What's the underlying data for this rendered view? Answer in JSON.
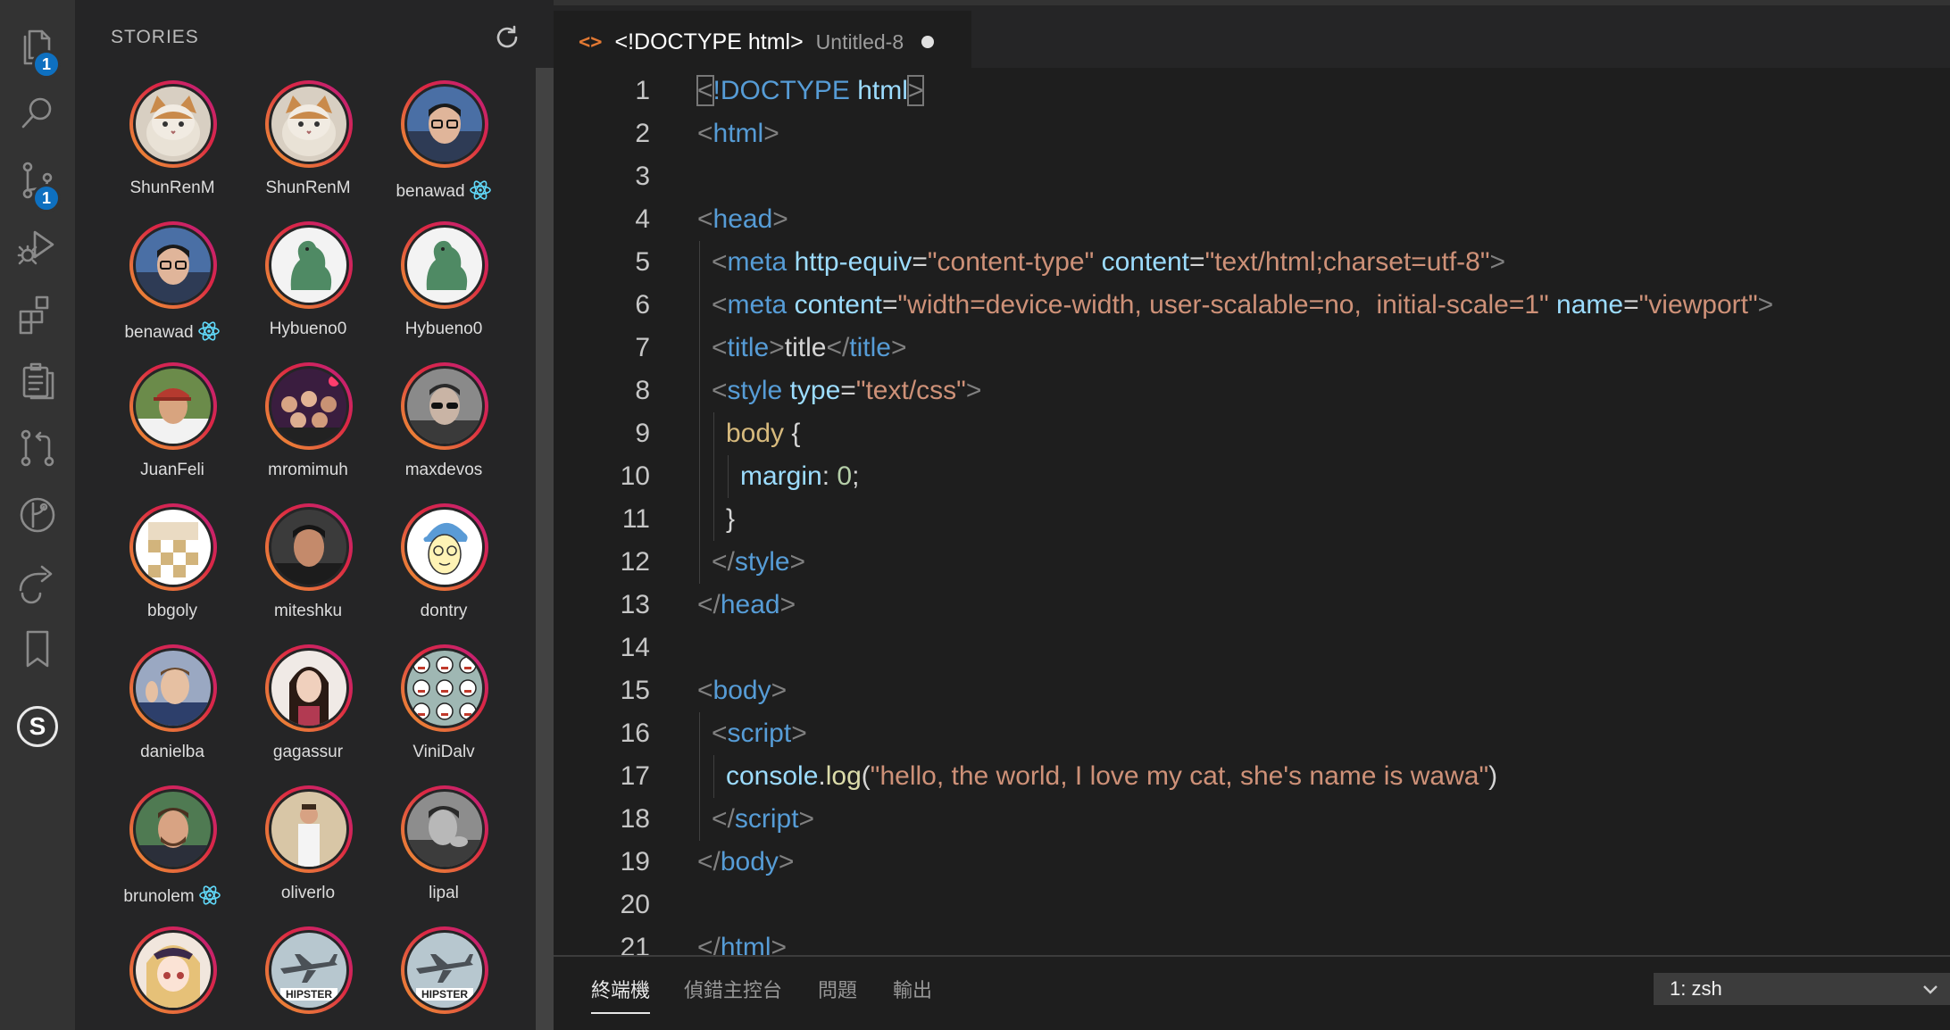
{
  "activity_bar": {
    "items": [
      {
        "name": "explorer",
        "icon": "files-icon",
        "badge": "1"
      },
      {
        "name": "search",
        "icon": "search-icon",
        "badge": ""
      },
      {
        "name": "source-control",
        "icon": "source-control-icon",
        "badge": "1"
      },
      {
        "name": "run-debug",
        "icon": "run-debug-icon",
        "badge": ""
      },
      {
        "name": "extensions",
        "icon": "extensions-icon",
        "badge": ""
      },
      {
        "name": "clipboard",
        "icon": "clipboard-icon",
        "badge": ""
      },
      {
        "name": "pull-requests",
        "icon": "pull-request-icon",
        "badge": ""
      },
      {
        "name": "git-graph",
        "icon": "git-graph-icon",
        "badge": ""
      },
      {
        "name": "live-share",
        "icon": "live-share-icon",
        "badge": ""
      },
      {
        "name": "bookmarks",
        "icon": "bookmark-icon",
        "badge": ""
      },
      {
        "name": "stories",
        "icon": "stories-s-icon",
        "badge": "",
        "glyph": "S"
      }
    ]
  },
  "sidebar": {
    "title": "STORIES",
    "refresh_icon": "refresh-icon",
    "stories": [
      {
        "name": "ShunRenM",
        "react": false,
        "avatar": "cat"
      },
      {
        "name": "ShunRenM",
        "react": false,
        "avatar": "cat"
      },
      {
        "name": "benawad",
        "react": true,
        "avatar": "man-glasses"
      },
      {
        "name": "benawad",
        "react": true,
        "avatar": "man-glasses"
      },
      {
        "name": "Hybueno0",
        "react": false,
        "avatar": "dino"
      },
      {
        "name": "Hybueno0",
        "react": false,
        "avatar": "dino"
      },
      {
        "name": "JuanFeli",
        "react": false,
        "avatar": "man-cap"
      },
      {
        "name": "mromimuh",
        "react": false,
        "avatar": "group"
      },
      {
        "name": "maxdevos",
        "react": false,
        "avatar": "man-sunglasses"
      },
      {
        "name": "bbgoly",
        "react": false,
        "avatar": "pixel"
      },
      {
        "name": "miteshku",
        "react": false,
        "avatar": "man-dark"
      },
      {
        "name": "dontry",
        "react": false,
        "avatar": "cartoon"
      },
      {
        "name": "danielba",
        "react": false,
        "avatar": "man-wave"
      },
      {
        "name": "gagassur",
        "react": false,
        "avatar": "woman"
      },
      {
        "name": "ViniDalv",
        "react": false,
        "avatar": "pattern"
      },
      {
        "name": "brunolem",
        "react": true,
        "avatar": "man-beard"
      },
      {
        "name": "oliverlo",
        "react": false,
        "avatar": "man-standing"
      },
      {
        "name": "lipal",
        "react": false,
        "avatar": "man-bw"
      },
      {
        "name": "",
        "react": false,
        "avatar": "anime"
      },
      {
        "name": "",
        "react": false,
        "avatar": "plane",
        "caption": "HIPSTER"
      },
      {
        "name": "",
        "react": false,
        "avatar": "plane",
        "caption": "HIPSTER"
      }
    ]
  },
  "editor": {
    "tab": {
      "icon": "<>",
      "title": "<!DOCTYPE html>",
      "description": "Untitled-8"
    },
    "lines": [
      {
        "n": "1",
        "indent": 0,
        "tokens": [
          [
            "punc-box",
            "<"
          ],
          [
            "tag",
            "!DOCTYPE"
          ],
          [
            "txt",
            " "
          ],
          [
            "attr",
            "html"
          ],
          [
            "punc-box",
            ">"
          ]
        ]
      },
      {
        "n": "2",
        "indent": 0,
        "tokens": [
          [
            "punc",
            "<"
          ],
          [
            "tag",
            "html"
          ],
          [
            "punc",
            ">"
          ]
        ]
      },
      {
        "n": "3",
        "indent": 0,
        "tokens": []
      },
      {
        "n": "4",
        "indent": 0,
        "tokens": [
          [
            "punc",
            "<"
          ],
          [
            "tag",
            "head"
          ],
          [
            "punc",
            ">"
          ]
        ]
      },
      {
        "n": "5",
        "indent": 1,
        "tokens": [
          [
            "punc",
            "<"
          ],
          [
            "tag",
            "meta"
          ],
          [
            "txt",
            " "
          ],
          [
            "attr",
            "http-equiv"
          ],
          [
            "txt",
            "="
          ],
          [
            "str",
            "\"content-type\""
          ],
          [
            "txt",
            " "
          ],
          [
            "attr",
            "content"
          ],
          [
            "txt",
            "="
          ],
          [
            "str",
            "\"text/html;charset=utf-8\""
          ],
          [
            "punc",
            ">"
          ]
        ]
      },
      {
        "n": "6",
        "indent": 1,
        "tokens": [
          [
            "punc",
            "<"
          ],
          [
            "tag",
            "meta"
          ],
          [
            "txt",
            " "
          ],
          [
            "attr",
            "content"
          ],
          [
            "txt",
            "="
          ],
          [
            "str",
            "\"width=device-width, user-scalable=no,  initial-scale=1\""
          ],
          [
            "txt",
            " "
          ],
          [
            "attr",
            "name"
          ],
          [
            "txt",
            "="
          ],
          [
            "str",
            "\"viewport\""
          ],
          [
            "punc",
            ">"
          ]
        ]
      },
      {
        "n": "7",
        "indent": 1,
        "tokens": [
          [
            "punc",
            "<"
          ],
          [
            "tag",
            "title"
          ],
          [
            "punc",
            ">"
          ],
          [
            "txt",
            "title"
          ],
          [
            "punc",
            "</"
          ],
          [
            "tag",
            "title"
          ],
          [
            "punc",
            ">"
          ]
        ]
      },
      {
        "n": "8",
        "indent": 1,
        "tokens": [
          [
            "punc",
            "<"
          ],
          [
            "tag",
            "style"
          ],
          [
            "txt",
            " "
          ],
          [
            "attr",
            "type"
          ],
          [
            "txt",
            "="
          ],
          [
            "str",
            "\"text/css\""
          ],
          [
            "punc",
            ">"
          ]
        ]
      },
      {
        "n": "9",
        "indent": 2,
        "tokens": [
          [
            "sel",
            "body"
          ],
          [
            "txt",
            " {"
          ]
        ]
      },
      {
        "n": "10",
        "indent": 3,
        "tokens": [
          [
            "attr",
            "margin"
          ],
          [
            "txt",
            ": "
          ],
          [
            "num",
            "0"
          ],
          [
            "txt",
            ";"
          ]
        ]
      },
      {
        "n": "11",
        "indent": 2,
        "tokens": [
          [
            "txt",
            "}"
          ]
        ]
      },
      {
        "n": "12",
        "indent": 1,
        "tokens": [
          [
            "punc",
            "</"
          ],
          [
            "tag",
            "style"
          ],
          [
            "punc",
            ">"
          ]
        ]
      },
      {
        "n": "13",
        "indent": 0,
        "tokens": [
          [
            "punc",
            "</"
          ],
          [
            "tag",
            "head"
          ],
          [
            "punc",
            ">"
          ]
        ]
      },
      {
        "n": "14",
        "indent": 0,
        "tokens": []
      },
      {
        "n": "15",
        "indent": 0,
        "tokens": [
          [
            "punc",
            "<"
          ],
          [
            "tag",
            "body"
          ],
          [
            "punc",
            ">"
          ]
        ]
      },
      {
        "n": "16",
        "indent": 1,
        "tokens": [
          [
            "punc",
            "<"
          ],
          [
            "tag",
            "script"
          ],
          [
            "punc",
            ">"
          ]
        ]
      },
      {
        "n": "17",
        "indent": 2,
        "tokens": [
          [
            "attr",
            "console"
          ],
          [
            "txt",
            "."
          ],
          [
            "fn",
            "log"
          ],
          [
            "txt",
            "("
          ],
          [
            "str",
            "\"hello, the world, I love my cat, she's name is wawa\""
          ],
          [
            "txt",
            ")"
          ]
        ]
      },
      {
        "n": "18",
        "indent": 1,
        "tokens": [
          [
            "punc",
            "</"
          ],
          [
            "tag",
            "script"
          ],
          [
            "punc",
            ">"
          ]
        ]
      },
      {
        "n": "19",
        "indent": 0,
        "tokens": [
          [
            "punc",
            "</"
          ],
          [
            "tag",
            "body"
          ],
          [
            "punc",
            ">"
          ]
        ]
      },
      {
        "n": "20",
        "indent": 0,
        "tokens": []
      },
      {
        "n": "21",
        "indent": 0,
        "tokens": [
          [
            "punc",
            "</"
          ],
          [
            "tag",
            "html"
          ],
          [
            "punc",
            ">"
          ]
        ]
      }
    ]
  },
  "panel": {
    "tabs": [
      "終端機",
      "偵錯主控台",
      "問題",
      "輸出"
    ],
    "active_tab": 0,
    "terminal_select": "1: zsh"
  },
  "colors": {
    "activity_bg": "#333333",
    "sidebar_bg": "#252526",
    "editor_bg": "#1e1e1e",
    "badge": "#0e70c0",
    "story_ring": "#dc2743"
  }
}
